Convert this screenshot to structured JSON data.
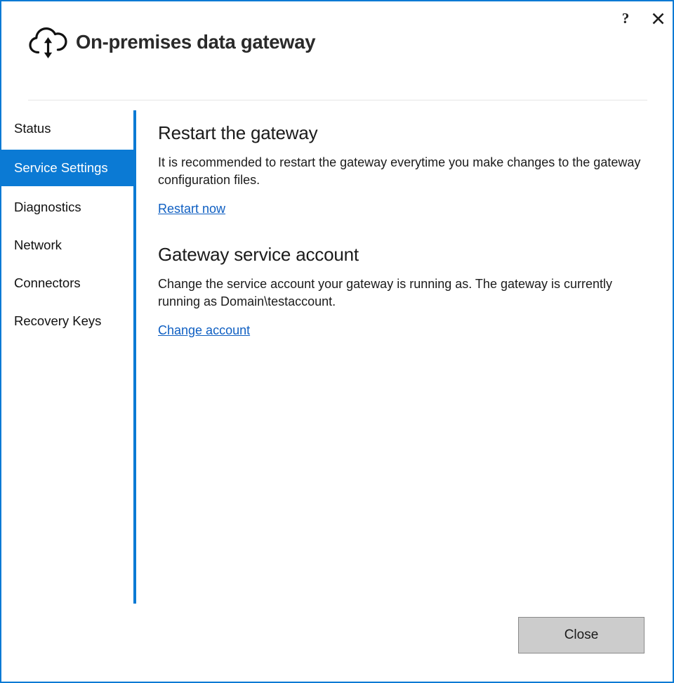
{
  "window": {
    "title": "On-premises data gateway",
    "icon": "cloud-sync-icon",
    "border_color": "#0b7ad4",
    "help_label": "?",
    "close_label": "✕"
  },
  "sidebar": {
    "selected": "Service Settings",
    "accent_color": "#0b7ad4",
    "items": [
      {
        "label": "Status"
      },
      {
        "label": "Service Settings"
      },
      {
        "label": "Diagnostics"
      },
      {
        "label": "Network"
      },
      {
        "label": "Connectors"
      },
      {
        "label": "Recovery Keys"
      }
    ]
  },
  "content": {
    "sections": [
      {
        "heading": "Restart the gateway",
        "body": "It is recommended to restart the gateway everytime you make changes to the gateway configuration files.",
        "link": "Restart now"
      },
      {
        "heading": "Gateway service account",
        "body": "Change the service account your gateway is running as. The gateway is currently running as Domain\\testaccount.",
        "link": "Change account"
      }
    ]
  },
  "footer": {
    "close_label": "Close"
  }
}
